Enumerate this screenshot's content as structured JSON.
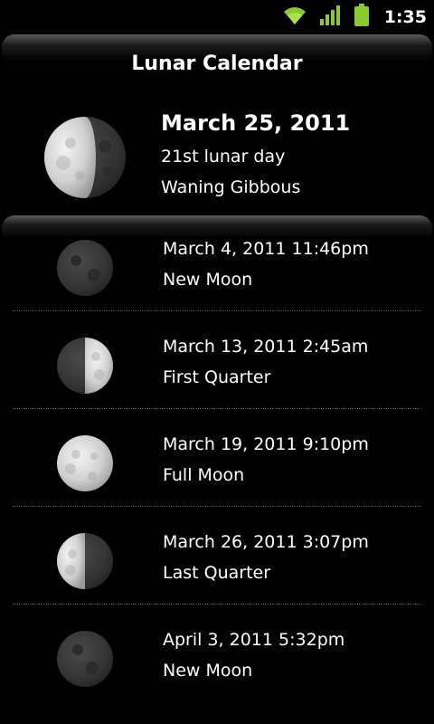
{
  "status_bar": {
    "time": "1:35",
    "icons": [
      "wifi-icon",
      "signal-icon",
      "battery-icon"
    ]
  },
  "app": {
    "title": "Lunar Calendar"
  },
  "today": {
    "date": "March 25, 2011",
    "lunar_day": "21st lunar day",
    "phase": "Waning Gibbous",
    "illumination": "waning-gibbous"
  },
  "events": [
    {
      "datetime": "March 4, 2011 11:46pm",
      "phase": "New Moon"
    },
    {
      "datetime": "March 13, 2011 2:45am",
      "phase": "First Quarter"
    },
    {
      "datetime": "March 19, 2011 9:10pm",
      "phase": "Full Moon"
    },
    {
      "datetime": "March 26, 2011 3:07pm",
      "phase": "Last Quarter"
    },
    {
      "datetime": "April 3, 2011 5:32pm",
      "phase": "New Moon"
    }
  ],
  "colors": {
    "background": "#000000",
    "text": "#ffffff",
    "status_accent": "#9be02e",
    "moon_light": "#d8d8d8",
    "moon_dark": "#3a3a3a"
  }
}
